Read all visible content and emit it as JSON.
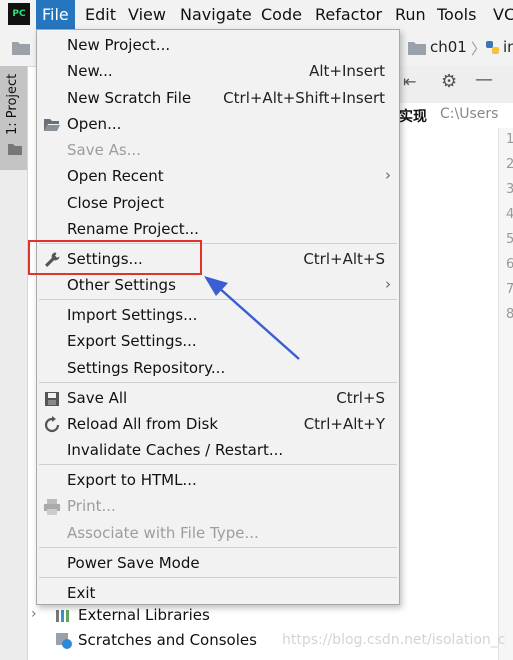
{
  "menubar": {
    "app_logo": "PC",
    "items": [
      "File",
      "Edit",
      "View",
      "Navigate",
      "Code",
      "Refactor",
      "Run",
      "Tools",
      "VC"
    ]
  },
  "toolbar": {
    "breadcrumb_folder": "ch01",
    "breadcrumb_file": "in"
  },
  "project_panel": {
    "tab_label": "1: Project",
    "path_partial": "实现",
    "path_hint": "C:\\Users"
  },
  "editor": {
    "line_numbers": [
      "1",
      "2",
      "3",
      "4",
      "5",
      "6",
      "7",
      "8"
    ]
  },
  "tree": {
    "items": [
      {
        "label": "External Libraries"
      },
      {
        "label": "Scratches and Consoles"
      }
    ]
  },
  "file_menu": {
    "items": [
      {
        "label": "New Project...",
        "shortcut": ""
      },
      {
        "label": "New...",
        "shortcut": "Alt+Insert"
      },
      {
        "label": "New Scratch File",
        "shortcut": "Ctrl+Alt+Shift+Insert"
      },
      {
        "label": "Open...",
        "shortcut": ""
      },
      {
        "label": "Save As...",
        "shortcut": ""
      },
      {
        "label": "Open Recent",
        "shortcut": ""
      },
      {
        "label": "Close Project",
        "shortcut": ""
      },
      {
        "label": "Rename Project...",
        "shortcut": ""
      },
      {
        "label": "Settings...",
        "shortcut": "Ctrl+Alt+S"
      },
      {
        "label": "Other Settings",
        "shortcut": ""
      },
      {
        "label": "Import Settings...",
        "shortcut": ""
      },
      {
        "label": "Export Settings...",
        "shortcut": ""
      },
      {
        "label": "Settings Repository...",
        "shortcut": ""
      },
      {
        "label": "Save All",
        "shortcut": "Ctrl+S"
      },
      {
        "label": "Reload All from Disk",
        "shortcut": "Ctrl+Alt+Y"
      },
      {
        "label": "Invalidate Caches / Restart...",
        "shortcut": ""
      },
      {
        "label": "Export to HTML...",
        "shortcut": ""
      },
      {
        "label": "Print...",
        "shortcut": ""
      },
      {
        "label": "Associate with File Type...",
        "shortcut": ""
      },
      {
        "label": "Power Save Mode",
        "shortcut": ""
      },
      {
        "label": "Exit",
        "shortcut": ""
      }
    ]
  },
  "watermark": "https://blog.csdn.net/isolation_c",
  "colors": {
    "menubar_active": "#2675bf",
    "highlight_box": "#e0332b",
    "annotation_arrow": "#3b5fd0",
    "menu_bg": "#f2f2f2",
    "disabled_text": "#9d9d9d"
  }
}
